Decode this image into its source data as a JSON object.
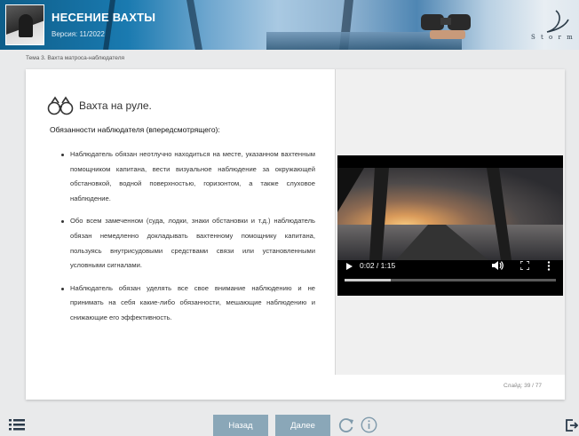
{
  "header": {
    "title": "НЕСЕНИЕ ВАХТЫ",
    "version": "Версия: 11/2022",
    "logo_text": "S t o r m"
  },
  "breadcrumb": "Тема 3. Вахта матроса-наблюдателя",
  "slide": {
    "heading": "Вахта на руле.",
    "subheading": "Обязанности наблюдателя (впередсмотрящего):",
    "bullets": [
      "Наблюдатель обязан неотлучно находиться на месте, указанном вахтенным помощником капитана, вести визуальное наблюдение за окружающей обстановкой, водной поверхностью, горизонтом, а также слуховое наблюдение.",
      "Обо всем замеченном (суда, лодки, знаки обстановки и т.д.) наблюдатель обязан немедленно докладывать вахтенному помощнику капитана, пользуясь внутрисудовыми средствами связи или установленными условными сигналами.",
      "Наблюдатель обязан уделять все свое внимание наблюдению и не принимать на себя какие-либо обязанности, мешающие наблюдению и снижающие его эффективность."
    ],
    "counter": "Слайд: 39 / 77"
  },
  "video": {
    "time": "0:02 / 1:15",
    "progress": 0.0267,
    "buffered": 0.22,
    "icons": [
      "play-icon",
      "volume-icon",
      "fullscreen-icon",
      "more-options-icon"
    ]
  },
  "nav": {
    "back_label": "Назад",
    "next_label": "Далее"
  },
  "colors": {
    "button_bg": "#8aa7b8",
    "header_blue": "#1a7ab0",
    "page_bg": "#e9eaeb"
  }
}
